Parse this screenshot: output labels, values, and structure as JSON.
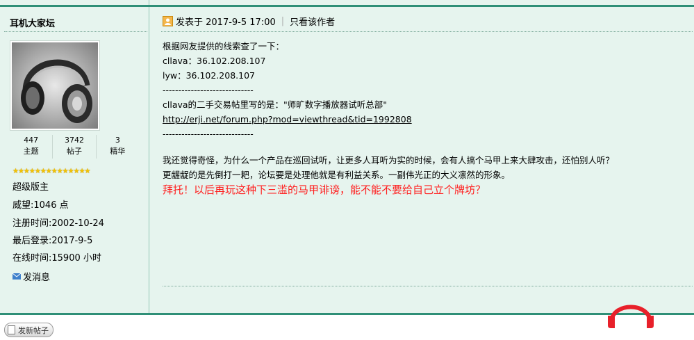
{
  "user": {
    "name": "耳机大家坛",
    "stats": [
      {
        "value": "447",
        "label": "主题"
      },
      {
        "value": "3742",
        "label": "帖子"
      },
      {
        "value": "3",
        "label": "精华"
      }
    ],
    "stars": "★★★★★★★★★★★★★★",
    "rank": "超级版主",
    "info": [
      "威望:1046 点",
      "注册时间:2002-10-24",
      "最后登录:2017-9-5",
      "在线时间:15900 小时"
    ],
    "pm_label": "发消息"
  },
  "post": {
    "posted_label": "发表于 2017-9-5 17:00",
    "separator": "|",
    "author_only": "只看该作者",
    "lines": [
      "根据网友提供的线索查了一下：",
      "cllava：36.102.208.107",
      "lyw：36.102.208.107",
      "-----------------------------",
      "cllava的二手交易帖里写的是：\"师旷数字播放器试听总部\"",
      "http://erji.net/forum.php?mod=viewthread&tid=1992808",
      "-----------------------------",
      "",
      "我还觉得奇怪，为什么一个产品在巡回试听，让更多人耳听为实的时候，会有人搞个马甲上来大肆攻击，还怕别人听？",
      "更龌龊的是先倒打一耙，论坛要是处理他就是有利益关系。一副伟光正的大义凛然的形象。"
    ],
    "highlight": "拜托！以后再玩这种下三滥的马甲诽谤，能不能不要给自己立个牌坊？"
  },
  "footer": {
    "new_post": "发新帖子"
  },
  "colors": {
    "background": "#e6f4ee",
    "accent": "#2f8f77",
    "highlight_text": "#ff2020",
    "logo": "#e8202a"
  },
  "icons": [
    "avatar-headphones",
    "post-icon",
    "envelope-icon",
    "new-post-icon",
    "headphone-logo-watermark"
  ]
}
